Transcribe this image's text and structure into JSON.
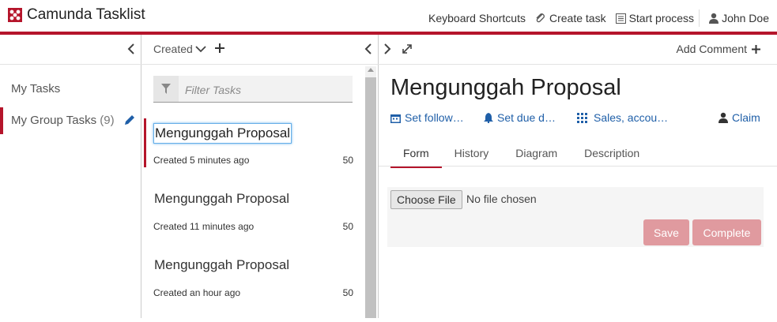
{
  "header": {
    "app_title": "Camunda Tasklist",
    "nav": {
      "shortcuts": "Keyboard Shortcuts",
      "create_task": "Create task",
      "start_process": "Start process",
      "user": "John Doe"
    }
  },
  "filters": {
    "items": [
      {
        "label": "My Tasks"
      },
      {
        "label": "My Group Tasks",
        "count": "(9)"
      }
    ]
  },
  "list": {
    "sort_label": "Created",
    "filter_placeholder": "Filter Tasks",
    "tasks": [
      {
        "name": "Mengunggah Proposal",
        "created": "Created 5 minutes ago",
        "priority": "50"
      },
      {
        "name": "Mengunggah Proposal",
        "created": "Created 11 minutes ago",
        "priority": "50"
      },
      {
        "name": "Mengunggah Proposal",
        "created": "Created an hour ago",
        "priority": "50"
      }
    ]
  },
  "detail": {
    "add_comment": "Add Comment",
    "title": "Mengunggah Proposal",
    "meta": {
      "follow_up": "Set follow…",
      "due_date": "Set due d…",
      "groups": "Sales, accou…",
      "claim": "Claim"
    },
    "tabs": [
      "Form",
      "History",
      "Diagram",
      "Description"
    ],
    "form": {
      "choose_file": "Choose File",
      "no_file": "No file chosen",
      "save": "Save",
      "complete": "Complete"
    }
  },
  "colors": {
    "accent": "#b5152b",
    "link": "#1f5fa8",
    "button_disabled": "#e09a9f"
  }
}
